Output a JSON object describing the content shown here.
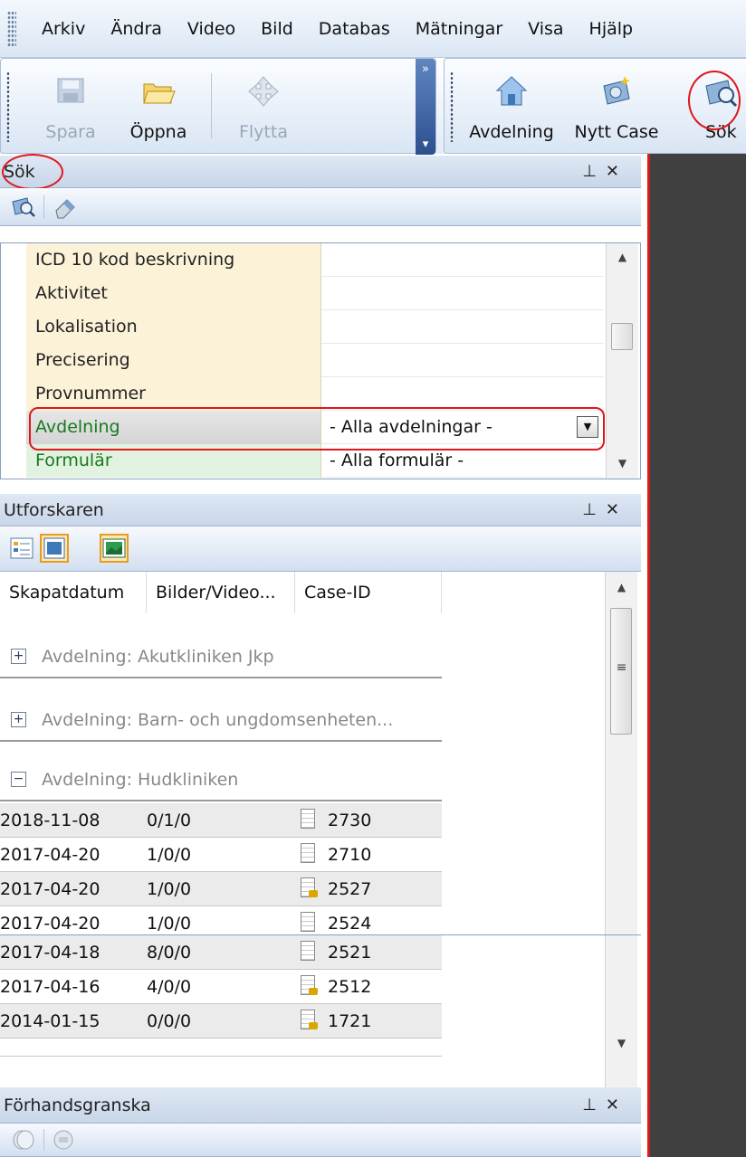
{
  "menu": [
    "Arkiv",
    "Ändra",
    "Video",
    "Bild",
    "Databas",
    "Mätningar",
    "Visa",
    "Hjälp"
  ],
  "toolbar": {
    "save_label": "Spara",
    "open_label": "Öppna",
    "move_label": "Flytta",
    "department_label": "Avdelning",
    "new_case_label": "Nytt Case",
    "search_label": "Sök"
  },
  "search_panel": {
    "title": "Sök",
    "pin": "ᵖ",
    "close": "✕",
    "rows": [
      {
        "name": "ICD 10 kod beskrivning",
        "value": ""
      },
      {
        "name": "Aktivitet",
        "value": ""
      },
      {
        "name": "Lokalisation",
        "value": ""
      },
      {
        "name": "Precisering",
        "value": ""
      },
      {
        "name": "Provnummer",
        "value": ""
      },
      {
        "name": "Avdelning",
        "value": "- Alla avdelningar -"
      },
      {
        "name": "Formulär",
        "value": "- Alla formulär -"
      }
    ]
  },
  "explorer": {
    "title": "Utforskaren",
    "columns": [
      "Skapatdatum",
      "Bilder/Video...",
      "Case-ID"
    ],
    "groups": [
      {
        "label": "Avdelning: Akutkliniken Jkp",
        "expanded": false
      },
      {
        "label": "Avdelning: Barn- och ungdomsenheten...",
        "expanded": false
      },
      {
        "label": "Avdelning: Hudkliniken",
        "expanded": true
      }
    ],
    "rows": [
      {
        "date": "2018-11-08",
        "media": "0/1/0",
        "id": "2730",
        "locked": false
      },
      {
        "date": "2017-04-20",
        "media": "1/0/0",
        "id": "2710",
        "locked": false
      },
      {
        "date": "2017-04-20",
        "media": "1/0/0",
        "id": "2527",
        "locked": true
      },
      {
        "date": "2017-04-20",
        "media": "1/0/0",
        "id": "2524",
        "locked": false
      },
      {
        "date": "2017-04-18",
        "media": "8/0/0",
        "id": "2521",
        "locked": false
      },
      {
        "date": "2017-04-16",
        "media": "4/0/0",
        "id": "2512",
        "locked": true
      },
      {
        "date": "2014-01-15",
        "media": "0/0/0",
        "id": "1721",
        "locked": true
      }
    ]
  },
  "preview_panel": {
    "title": "Förhandsgranska"
  },
  "colors": {
    "accent_red": "#e0161b",
    "property_name_bg": "#fcf2d8",
    "green_text": "#177a1d",
    "dark_pane": "#404040"
  }
}
